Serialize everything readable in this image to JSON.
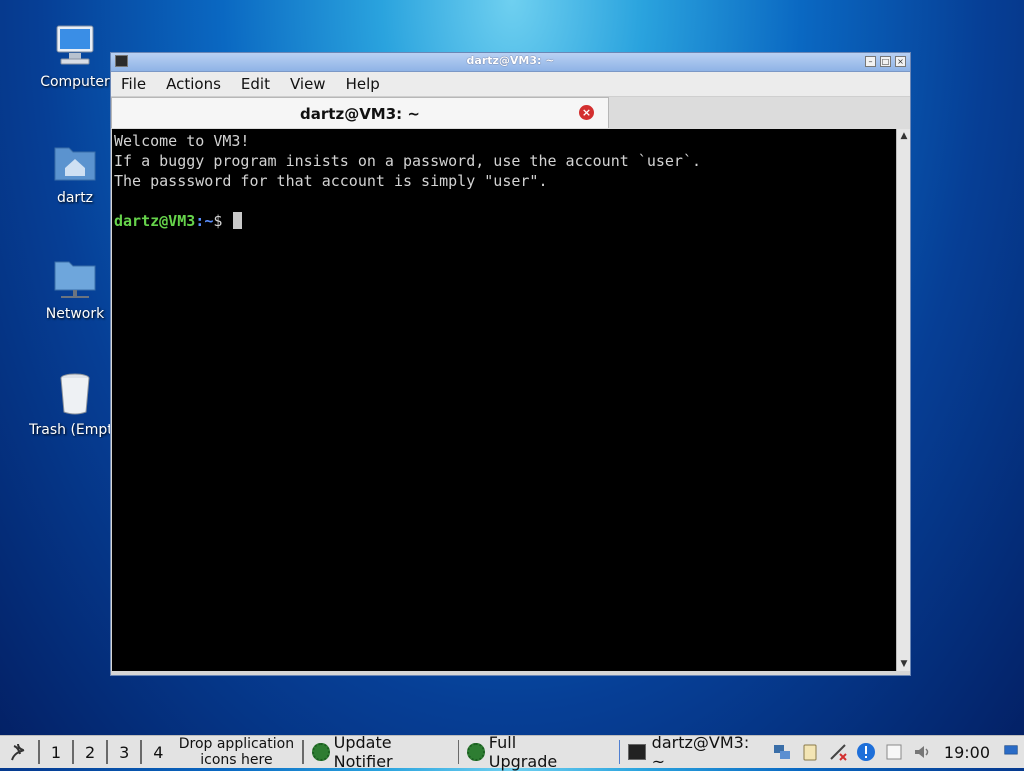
{
  "desktop": {
    "icons": [
      {
        "label": "Computer"
      },
      {
        "label": "dartz"
      },
      {
        "label": "Network"
      },
      {
        "label": "Trash (Empty)"
      }
    ]
  },
  "window": {
    "title": "dartz@VM3: ~",
    "menu": [
      "File",
      "Actions",
      "Edit",
      "View",
      "Help"
    ],
    "tab_title": "dartz@VM3: ~"
  },
  "terminal": {
    "lines": [
      "Welcome to VM3!",
      "If a buggy program insists on a password, use the account `user`.",
      "The passsword for that account is simply \"user\"."
    ],
    "prompt_user": "dartz@VM3",
    "prompt_sep": ":",
    "prompt_path": "~",
    "prompt_symbol": "$ "
  },
  "taskbar": {
    "workspaces": [
      "1",
      "2",
      "3",
      "4"
    ],
    "drop_text": "Drop application icons here",
    "tasks": [
      "Update Notifier",
      "Full Upgrade",
      "dartz@VM3: ~"
    ],
    "clock": "19:00"
  }
}
